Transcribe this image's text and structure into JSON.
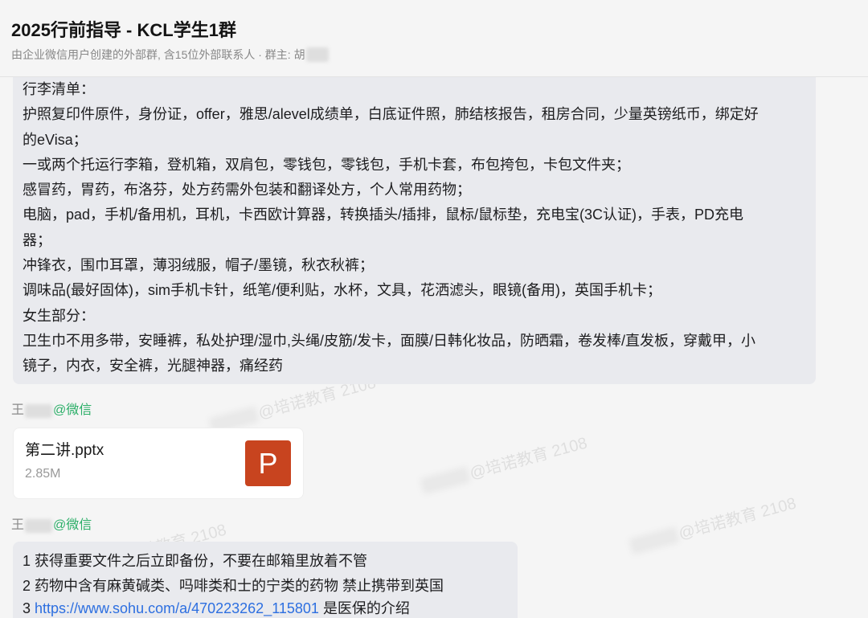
{
  "header": {
    "title": "2025行前指导 - KCL学生1群",
    "subtitle": "由企业微信用户创建的外部群, 含15位外部联系人 · 群主: 胡"
  },
  "messages": [
    {
      "lines": [
        "行李清单：",
        "护照复印件原件，身份证，offer，雅思/alevel成绩单，白底证件照，肺结核报告，租房合同，少量英镑纸币，绑定好",
        "的eVisa；",
        "一或两个托运行李箱，登机箱，双肩包，零钱包，零钱包，手机卡套，布包挎包，卡包文件夹；",
        "感冒药，胃药，布洛芬，处方药需外包装和翻译处方，个人常用药物；",
        "电脑，pad，手机/备用机，耳机，卡西欧计算器，转换插头/插排，鼠标/鼠标垫，充电宝(3C认证)，手表，PD充电",
        "器；",
        "冲锋衣，围巾耳罩，薄羽绒服，帽子/墨镜，秋衣秋裤；",
        "调味品(最好固体)，sim手机卡针，纸笔/便利贴，水杯，文具，花洒滤头，眼镜(备用)，英国手机卡；",
        "女生部分：",
        "卫生巾不用多带，安睡裤，私处护理/湿巾,头绳/皮筋/发卡，面膜/日韩化妆品，防晒霜，卷发棒/直发板，穿戴甲，小",
        "镜子，内衣，安全裤，光腿神器，痛经药"
      ]
    },
    {
      "sender": {
        "name": "王",
        "tag": "@微信"
      },
      "file": {
        "name": "第二讲.pptx",
        "size": "2.85M",
        "icon": "powerpoint-icon",
        "icon_letter": "P"
      }
    },
    {
      "sender": {
        "name": "王",
        "tag": "@微信"
      },
      "lines": [
        {
          "text": "1 获得重要文件之后立即备份，不要在邮箱里放着不管"
        },
        {
          "text": "2 药物中含有麻黄碱类、吗啡类和士的宁类的药物 禁止携带到英国"
        },
        {
          "prefix": "3",
          "link": "https://www.sohu.com/a/470223262_115801",
          "suffix": "是医保的介绍"
        }
      ]
    }
  ],
  "watermark": {
    "text": "@培诺教育 2108"
  },
  "colors": {
    "page_bg": "#f5f5f5",
    "bubble_bg": "#e9eaee",
    "sender_tag_green": "#2aae67",
    "link_blue": "#2d6fe0",
    "ppt_orange": "#c8441f"
  }
}
